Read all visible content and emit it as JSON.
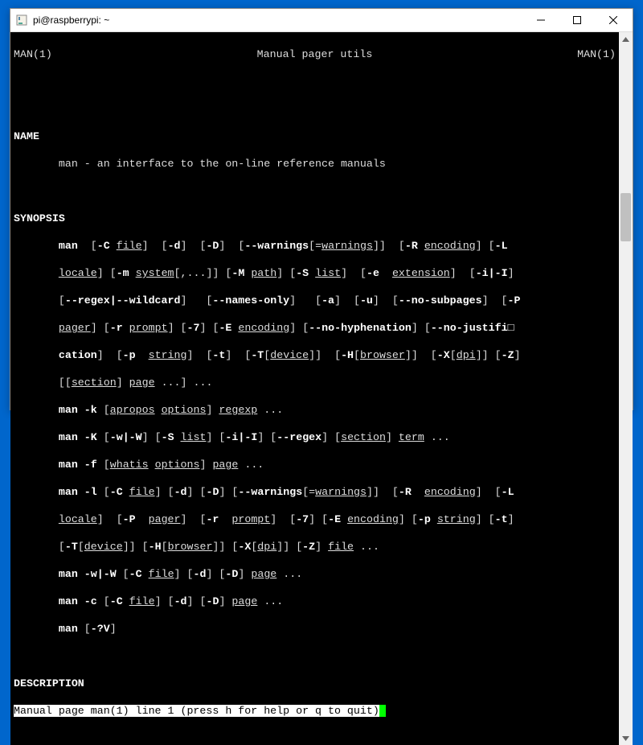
{
  "window": {
    "title": "pi@raspberrypi: ~"
  },
  "header": {
    "left": "MAN(1)",
    "center": "Manual pager utils",
    "right": "MAN(1)"
  },
  "sections": {
    "name_label": "NAME",
    "name_text": "man - an interface to the on-line reference manuals",
    "synopsis_label": "SYNOPSIS",
    "description_label": "DESCRIPTION"
  },
  "syn": {
    "cmd": "man",
    "flags": {
      "C": "-C",
      "d": "-d",
      "D": "-D",
      "warnings": "--warnings",
      "R": "-R",
      "L": "-L",
      "m": "-m",
      "M": "-M",
      "S": "-S",
      "e": "-e",
      "iI": "-i|-I",
      "regex_wildcard": "--regex|--wildcard",
      "names_only": "--names-only",
      "a": "-a",
      "u": "-u",
      "no_subpages": "--no-subpages",
      "P": "-P",
      "r": "-r",
      "seven": "-7",
      "E": "-E",
      "no_hyph": "--no-hyphenation",
      "no_just": "--no-justifi□",
      "cation": "cation",
      "p": "-p",
      "t": "-t",
      "T": "-T",
      "H": "-H",
      "X": "-X",
      "Z": "-Z",
      "k": "-k",
      "K": "-K",
      "wW": "-w|-W",
      "f": "-f",
      "l": "-l",
      "c": "-c",
      "qV": "-?V",
      "regex_flag": "--regex"
    },
    "args": {
      "file": "file",
      "warnings": "warnings",
      "encoding": "encoding",
      "locale": "locale",
      "system": "system",
      "path": "path",
      "list": "list",
      "extension": "extension",
      "pager": "pager",
      "prompt": "prompt",
      "string": "string",
      "device": "device",
      "browser": "browser",
      "dpi": "dpi",
      "section": "section",
      "page": "page",
      "apropos": "apropos",
      "options": "options",
      "regexp": "regexp",
      "term": "term",
      "whatis": "whatis"
    },
    "ellipsis": "...",
    "comma": ","
  },
  "status": "Manual page man(1) line 1 (press h for help or q to quit)"
}
